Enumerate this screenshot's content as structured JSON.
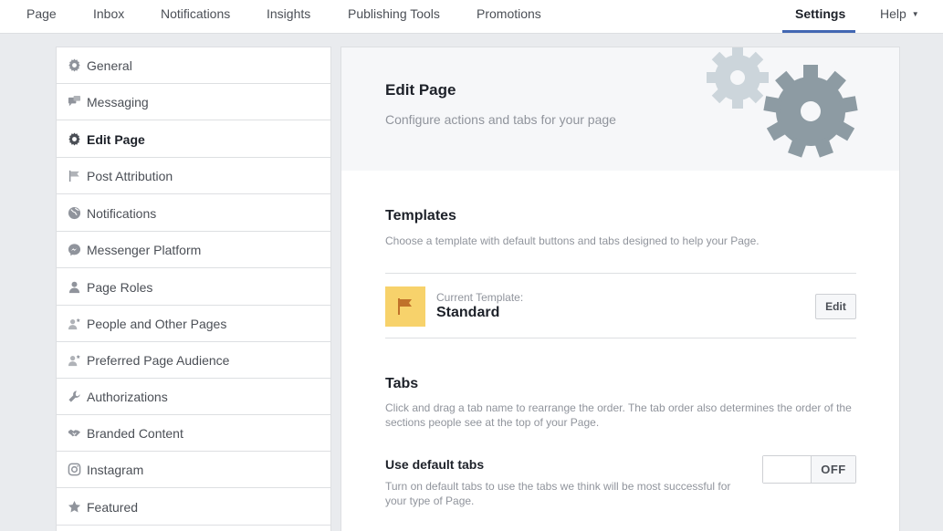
{
  "topnav": {
    "items": [
      {
        "label": "Page"
      },
      {
        "label": "Inbox"
      },
      {
        "label": "Notifications"
      },
      {
        "label": "Insights"
      },
      {
        "label": "Publishing Tools"
      },
      {
        "label": "Promotions"
      },
      {
        "label": "Settings"
      },
      {
        "label": "Help"
      }
    ],
    "active": "Settings"
  },
  "sidebar": {
    "items": [
      {
        "label": "General",
        "icon": "gear-icon"
      },
      {
        "label": "Messaging",
        "icon": "chat-bubbles-icon"
      },
      {
        "label": "Edit Page",
        "icon": "gear-icon"
      },
      {
        "label": "Post Attribution",
        "icon": "flag-icon"
      },
      {
        "label": "Notifications",
        "icon": "globe-icon"
      },
      {
        "label": "Messenger Platform",
        "icon": "messenger-icon"
      },
      {
        "label": "Page Roles",
        "icon": "person-icon"
      },
      {
        "label": "People and Other Pages",
        "icon": "person-star-icon"
      },
      {
        "label": "Preferred Page Audience",
        "icon": "person-star-icon"
      },
      {
        "label": "Authorizations",
        "icon": "wrench-icon"
      },
      {
        "label": "Branded Content",
        "icon": "handshake-icon"
      },
      {
        "label": "Instagram",
        "icon": "instagram-icon"
      },
      {
        "label": "Featured",
        "icon": "star-icon"
      }
    ],
    "active": "Edit Page"
  },
  "hero": {
    "title": "Edit Page",
    "subtitle": "Configure actions and tabs for your page"
  },
  "templates": {
    "title": "Templates",
    "description": "Choose a template with default buttons and tabs designed to help your Page.",
    "current_label": "Current Template:",
    "current_name": "Standard",
    "edit_label": "Edit"
  },
  "tabs": {
    "title": "Tabs",
    "description_line1": "Click and drag a tab name to rearrange the order. The tab order also determines the order of the",
    "description_line2": "sections people see at the top of your Page.",
    "default_tabs": {
      "title": "Use default tabs",
      "description": "Turn on default tabs to use the tabs we think will be most successful for your type of Page.",
      "toggle_state": "OFF"
    }
  },
  "colors": {
    "accent": "#4267b2",
    "template_icon_bg": "#f7d26b",
    "gear_dark": "#8d9ba3",
    "gear_light": "#ccd5db"
  }
}
